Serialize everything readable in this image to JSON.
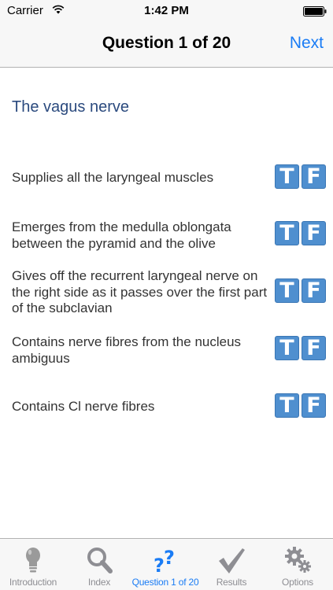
{
  "status_bar": {
    "carrier": "Carrier",
    "time": "1:42 PM",
    "wifi_icon": "wifi-icon",
    "battery_icon": "battery-icon"
  },
  "nav": {
    "title": "Question 1 of 20",
    "next_label": "Next"
  },
  "question": {
    "heading": "The vagus nerve",
    "statements": [
      {
        "text": "Supplies all the laryngeal muscles",
        "true_label": "T",
        "false_label": "F"
      },
      {
        "text": "Emerges from the medulla oblongata between the pyramid and the olive",
        "true_label": "T",
        "false_label": "F"
      },
      {
        "text": "Gives off the recurrent laryngeal nerve on the right side as it passes over the first part of the subclavian",
        "true_label": "T",
        "false_label": "F"
      },
      {
        "text": "Contains nerve fibres from the nucleus ambiguus",
        "true_label": "T",
        "false_label": "F"
      },
      {
        "text": "Contains Cl nerve fibres",
        "true_label": "T",
        "false_label": "F"
      }
    ]
  },
  "tab_bar": {
    "items": [
      {
        "label": "Introduction",
        "icon": "lightbulb-icon"
      },
      {
        "label": "Index",
        "icon": "magnifier-icon"
      },
      {
        "label": "Question 1 of 20",
        "icon": "question-marks-icon",
        "active": true
      },
      {
        "label": "Results",
        "icon": "checkmark-icon"
      },
      {
        "label": "Options",
        "icon": "gears-icon"
      }
    ]
  },
  "colors": {
    "accent": "#1a7cf5",
    "heading": "#2b4a7e",
    "tf_button": "#4f8fcf",
    "inactive_tab": "#8e8e93"
  }
}
